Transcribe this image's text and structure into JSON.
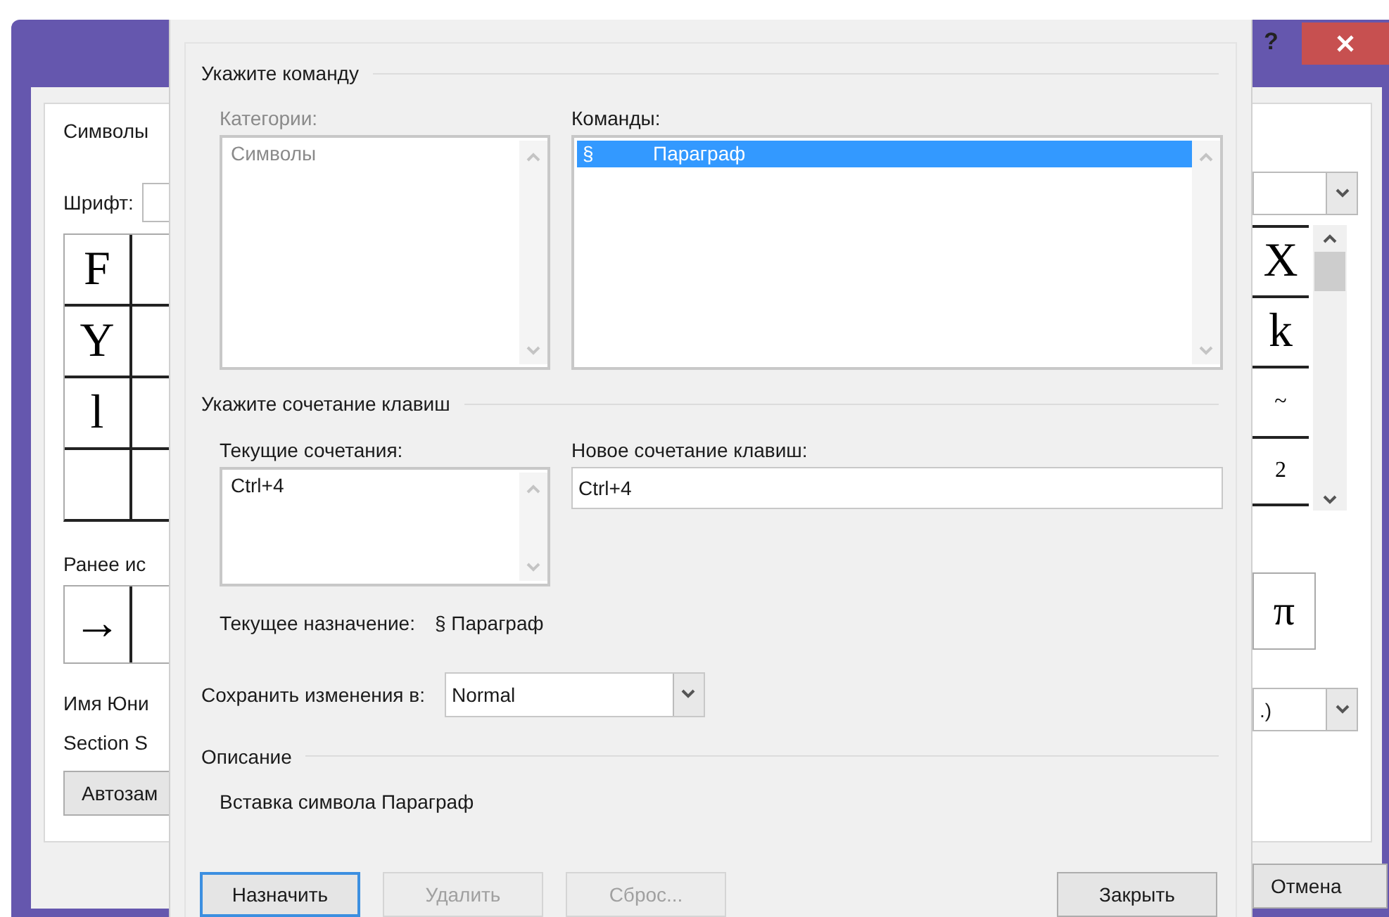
{
  "symbol_dialog": {
    "help": "?",
    "tab": "Символы",
    "font_label": "Шрифт:",
    "left_symbols": [
      "F",
      "Y",
      "l"
    ],
    "right_symbols": [
      "X",
      "k",
      "~",
      "2"
    ],
    "recent_label": "Ранее ис",
    "recent_left": "→",
    "recent_right": "π",
    "unicode_label": "Имя Юни",
    "unicode_value": "Section S",
    "autocorrect_button": "Автозам",
    "code_dropdown": ".)",
    "cancel_button": "Отмена"
  },
  "keyboard_dialog": {
    "command_section": "Укажите команду",
    "categories": {
      "label": "Категории:",
      "disabled": true,
      "items": [
        {
          "label": "Символы",
          "selected": false
        }
      ]
    },
    "commands": {
      "label": "Команды:",
      "disabled": false,
      "items": [
        {
          "symbol": "§",
          "label": "Параграф",
          "selected": true
        }
      ]
    },
    "keys_section": "Укажите сочетание клавиш",
    "current_keys": {
      "label": "Текущие сочетания:",
      "items": [
        "Ctrl+4"
      ]
    },
    "new_key": {
      "label": "Новое сочетание клавиш:",
      "value": "Ctrl+4"
    },
    "current_assignment": {
      "label": "Текущее назначение:",
      "value": "§ Параграф"
    },
    "save_in": {
      "label": "Сохранить изменения в:",
      "value": "Normal"
    },
    "description_section": "Описание",
    "description": "Вставка символа Параграф",
    "buttons": [
      {
        "label": "Назначить",
        "kind": "left",
        "focused": true,
        "disabled": false
      },
      {
        "label": "Удалить",
        "kind": "left",
        "focused": false,
        "disabled": true
      },
      {
        "label": "Сброс...",
        "kind": "left",
        "focused": false,
        "disabled": true
      },
      {
        "label": "Закрыть",
        "kind": "right",
        "focused": false,
        "disabled": false
      }
    ]
  }
}
